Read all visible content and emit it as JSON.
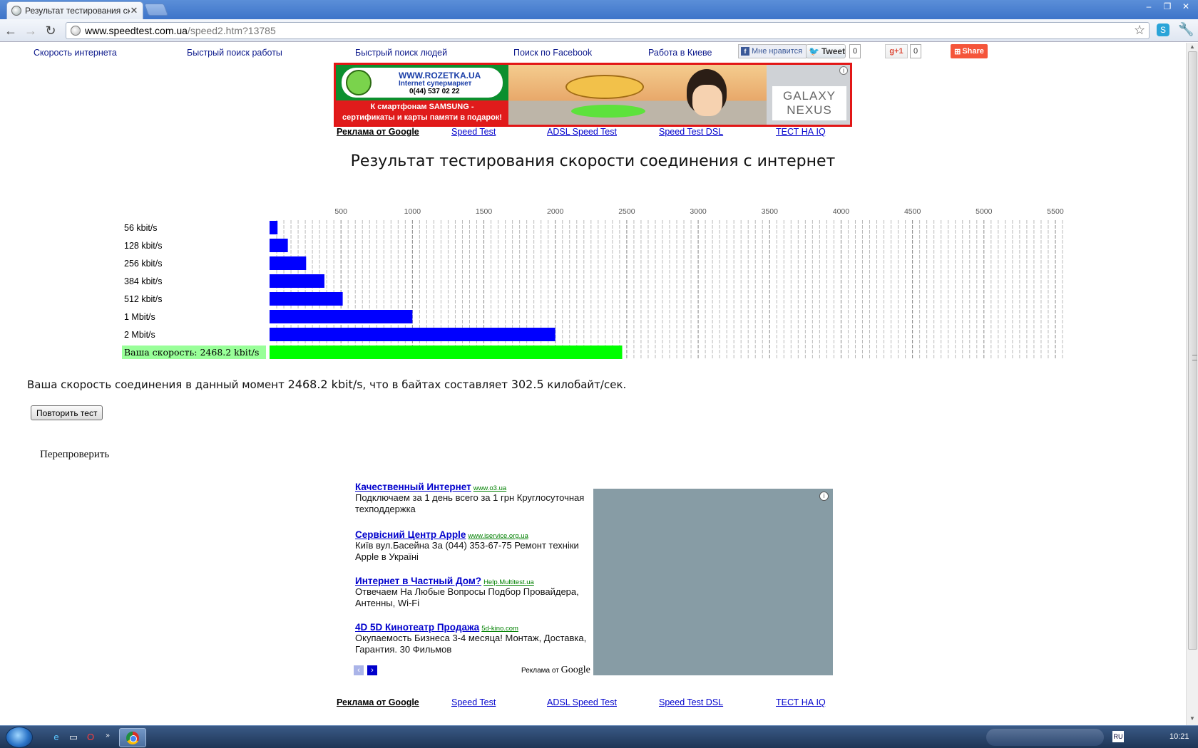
{
  "browser": {
    "tab_title": "Результат тестирования ско",
    "url_host": "www.speedtest.com.ua",
    "url_path": "/speed2.htm?13785"
  },
  "top_nav": [
    "Скорость интернета",
    "Быстрый поиск работы",
    "Быстрый поиск людей",
    "Поиск по Facebook",
    "Работа в Киеве"
  ],
  "social": {
    "fb_label": "Мне нравится",
    "tweet_label": "Tweet",
    "tweet_count": "0",
    "gplus_label": "+1",
    "gplus_count": "0",
    "share_label": "Share"
  },
  "banner": {
    "site": "WWW.ROZETKA.UA",
    "tagline": "Internet супермаркет",
    "phone": "0(44) 537 02 22",
    "promo_line1": "К смартфонам SAMSUNG -",
    "promo_line2": "сертификаты и карты памяти в подарок!",
    "product_line1": "GALAXY",
    "product_line2": "NEXUS"
  },
  "ad_links": {
    "google": "Реклама от Google",
    "speed_test": "Speed Test",
    "adsl": "ADSL Speed Test",
    "dsl": "Speed Test DSL",
    "iq": "ТЕСТ НА IQ"
  },
  "heading": "Результат тестирования скорости соединения с интернет",
  "chart_data": {
    "type": "bar",
    "orientation": "horizontal",
    "categories": [
      "56 kbit/s",
      "128 kbit/s",
      "256 kbit/s",
      "384 kbit/s",
      "512 kbit/s",
      "1 Mbit/s",
      "2 Mbit/s",
      "Ваша скорость: 2468.2 kbit/s"
    ],
    "values": [
      56,
      128,
      256,
      384,
      512,
      1000,
      2000,
      2468.2
    ],
    "bar_colors": [
      "#0000ff",
      "#0000ff",
      "#0000ff",
      "#0000ff",
      "#0000ff",
      "#0000ff",
      "#0000ff",
      "#00ff00"
    ],
    "highlight_label_bg": "#99ff99",
    "x_ticks": [
      "500",
      "1000",
      "1500",
      "2000",
      "2500",
      "3000",
      "3500",
      "4000",
      "4500",
      "5000",
      "5500"
    ],
    "xlim": [
      0,
      5550
    ],
    "grid": true
  },
  "result": {
    "prefix": "Ваша скорость соединения в данный момент",
    "speed": "2468.2 kbit/s",
    "middle": ", что в байтах составляет",
    "bytes": "302.5",
    "suffix": "килобайт/сек."
  },
  "repeat_button": "Повторить тест",
  "recheck_label": "Перепроверить",
  "text_ads": [
    {
      "title": "Качественный Интернет",
      "url": "www.o3.ua",
      "desc": "Подключаем за 1 день всего за 1 грн Круглосуточная техподдержка"
    },
    {
      "title": "Сервісний Центр Apple",
      "url": "www.iservice.org.ua",
      "desc": "Київ вул.Басейна За (044) 353-67-75 Ремонт техніки Apple в Україні"
    },
    {
      "title": "Интернет в Частный Дом?",
      "url": "Help.Multitest.ua",
      "desc": "Отвечаем На Любые Вопросы Подбор Провайдера, Антенны, Wi-Fi"
    },
    {
      "title": "4D 5D Кинотеатр Продажа",
      "url": "5d-kino.com",
      "desc": "Окупаемость Бизнеса 3-4 месяца! Монтаж, Доставка, Гарантия. 30 Фильмов"
    }
  ],
  "adsense_by": "Реклама от",
  "adsense_brand": "Google",
  "taskbar": {
    "lang": "RU",
    "time": "10:21"
  }
}
